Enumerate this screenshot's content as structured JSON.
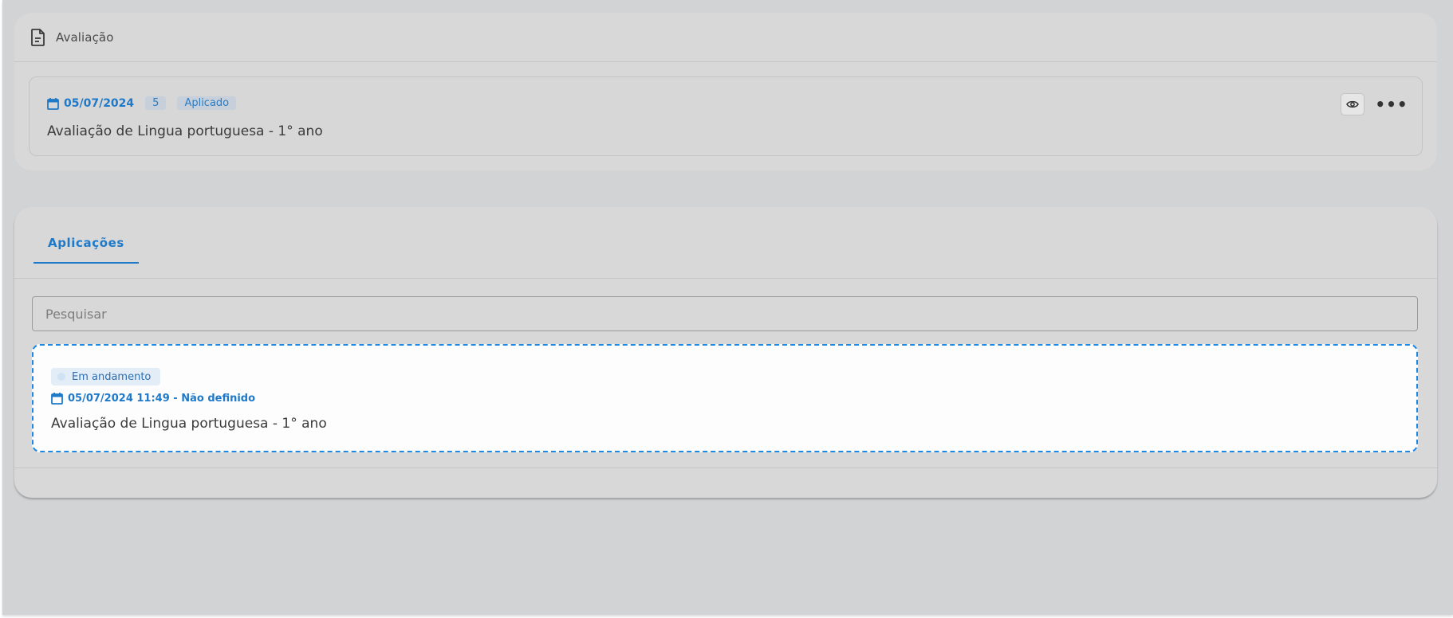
{
  "evaluation_card": {
    "title": "Avaliação",
    "item": {
      "date": "05/07/2024",
      "count": "5",
      "status": "Aplicado",
      "title": "Avaliação de Lingua portuguesa - 1° ano",
      "more_label": "•••"
    }
  },
  "applications_card": {
    "tabs": [
      {
        "label": "Aplicações",
        "active": true
      }
    ],
    "search": {
      "placeholder": "Pesquisar",
      "value": ""
    },
    "items": [
      {
        "status": "Em andamento",
        "datetime": "05/07/2024 11:49 - Não definido",
        "title": "Avaliação de Lingua portuguesa - 1° ano"
      }
    ]
  },
  "colors": {
    "accent": "#1f79c9",
    "background": "#d2d3d5",
    "card": "#d8d8d8",
    "selected_item_border": "#1e88e5"
  },
  "icons": [
    "document-icon",
    "calendar-icon",
    "eye-icon",
    "more-horizontal-icon",
    "status-dot-icon"
  ]
}
